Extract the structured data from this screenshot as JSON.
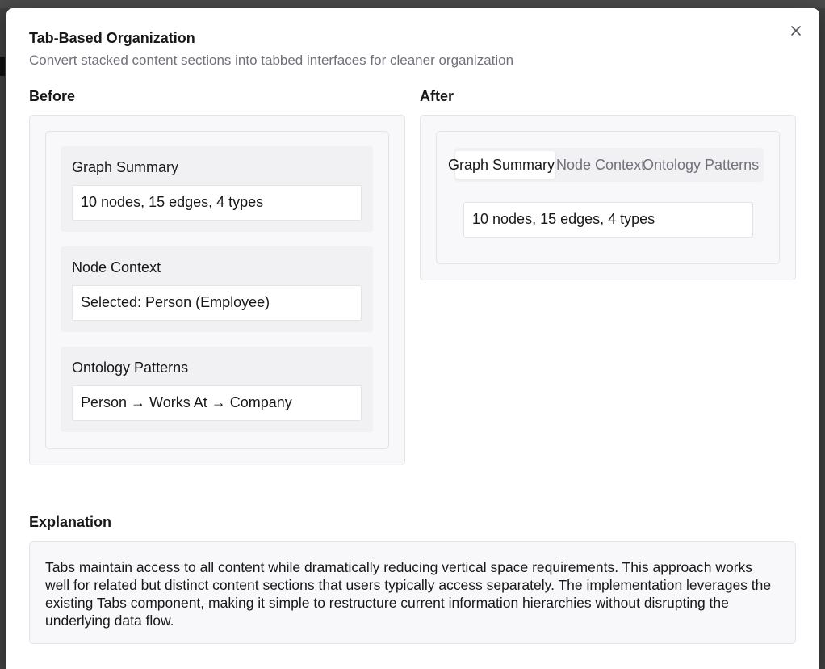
{
  "dialog": {
    "title": "Tab-Based Organization",
    "subtitle": "Convert stacked content sections into tabbed interfaces for cleaner organization",
    "close_icon": "close-icon"
  },
  "before": {
    "label": "Before",
    "sections": [
      {
        "title": "Graph Summary",
        "value": "10 nodes, 15 edges, 4 types"
      },
      {
        "title": "Node Context",
        "value": "Selected: Person (Employee)"
      },
      {
        "title": "Ontology Patterns",
        "value": "Person → Works At → Company"
      }
    ]
  },
  "after": {
    "label": "After",
    "tabs": [
      {
        "label": "Graph Summary",
        "active": true
      },
      {
        "label": "Node Context",
        "active": false
      },
      {
        "label": "Ontology Patterns",
        "active": false
      }
    ],
    "active_content": "10 nodes, 15 edges, 4 types"
  },
  "explanation": {
    "label": "Explanation",
    "text": "Tabs maintain access to all content while dramatically reducing vertical space requirements. This approach works well for related but distinct content sections that users typically access separately. The implementation leverages the existing Tabs component, making it simple to restructure current information hierarchies without disrupting the underlying data flow."
  },
  "colors": {
    "text_primary": "#18181b",
    "text_muted": "#71717a",
    "panel_bg": "#f8f8fa",
    "border": "#e4e4e7"
  }
}
